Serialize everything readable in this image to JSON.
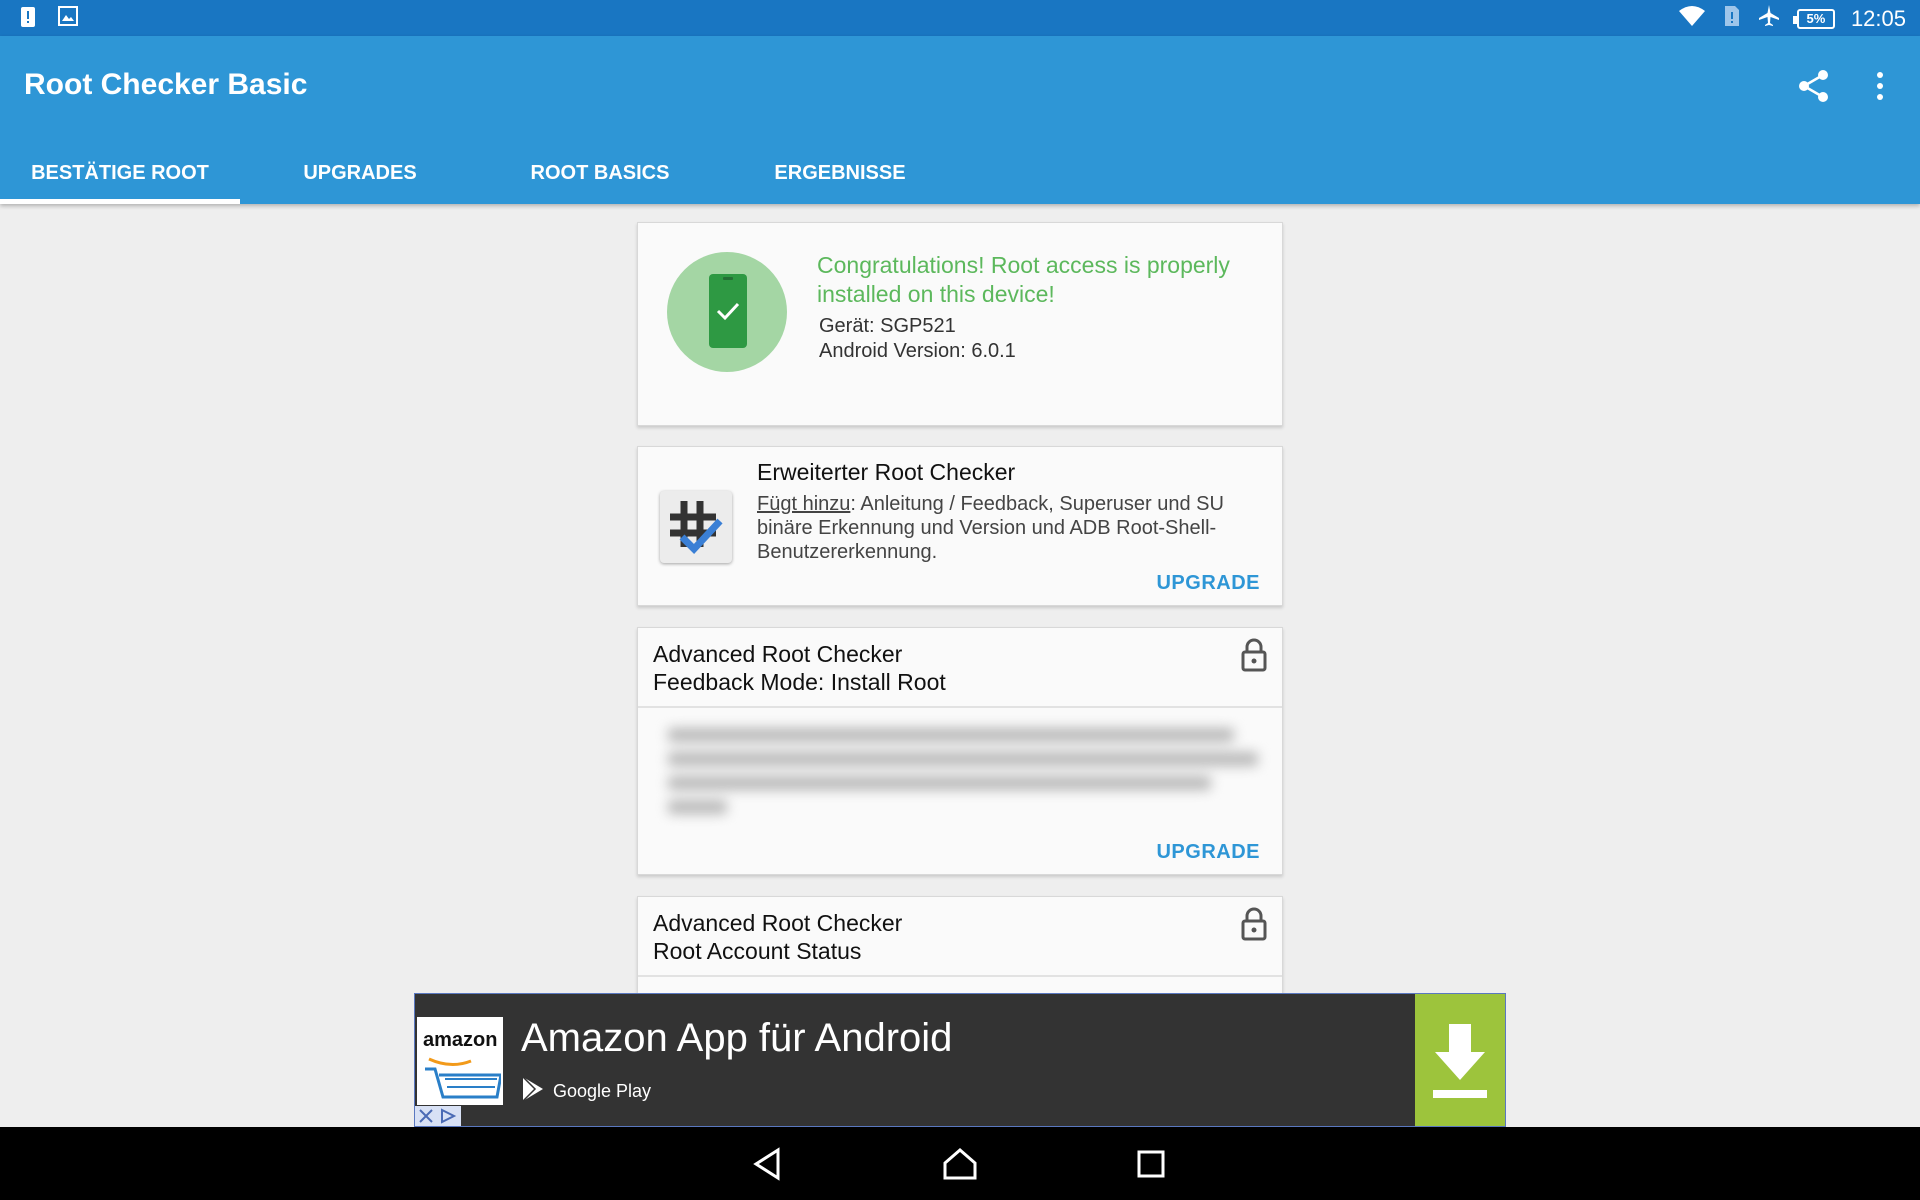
{
  "status_bar": {
    "time": "12:05",
    "battery": "5%",
    "left_icons": [
      "notification-alert-icon",
      "gallery-icon"
    ],
    "right_icons": [
      "wifi-icon",
      "sim-icon",
      "airplane-icon",
      "battery-icon"
    ]
  },
  "app_bar": {
    "title": "Root Checker Basic",
    "actions": [
      "share-icon",
      "overflow-menu-icon"
    ],
    "background": "#2e96d6"
  },
  "tabs": [
    {
      "label": "BESTÄTIGE ROOT",
      "active": true
    },
    {
      "label": "UPGRADES",
      "active": false
    },
    {
      "label": "ROOT BASICS",
      "active": false
    },
    {
      "label": "ERGEBNISSE",
      "active": false
    }
  ],
  "status_card": {
    "message": "Congratulations! Root access is properly installed on this device!",
    "device": "Gerät: SGP521",
    "android_version": "Android Version: 6.0.1",
    "message_color": "#5cb85c"
  },
  "upgrade_card": {
    "title": "Erweiterter Root Checker",
    "adds_label": "Fügt hinzu",
    "description": ": Anleitung / Feedback, Superuser und SU binäre Erkennung und Version und ADB Root-Shell-Benutzererkennung.",
    "button": "UPGRADE"
  },
  "locked_cards": [
    {
      "line1": "Advanced Root Checker",
      "line2": "Feedback Mode: Install Root",
      "button": "UPGRADE"
    },
    {
      "line1": "Advanced Root Checker",
      "line2": "Root Account Status"
    }
  ],
  "ad": {
    "logo_text": "amazon",
    "title": "Amazon App für Android",
    "store": "Google Play",
    "accent": "#9dc43c"
  },
  "nav_bar": [
    "back-icon",
    "home-icon",
    "recents-icon"
  ]
}
